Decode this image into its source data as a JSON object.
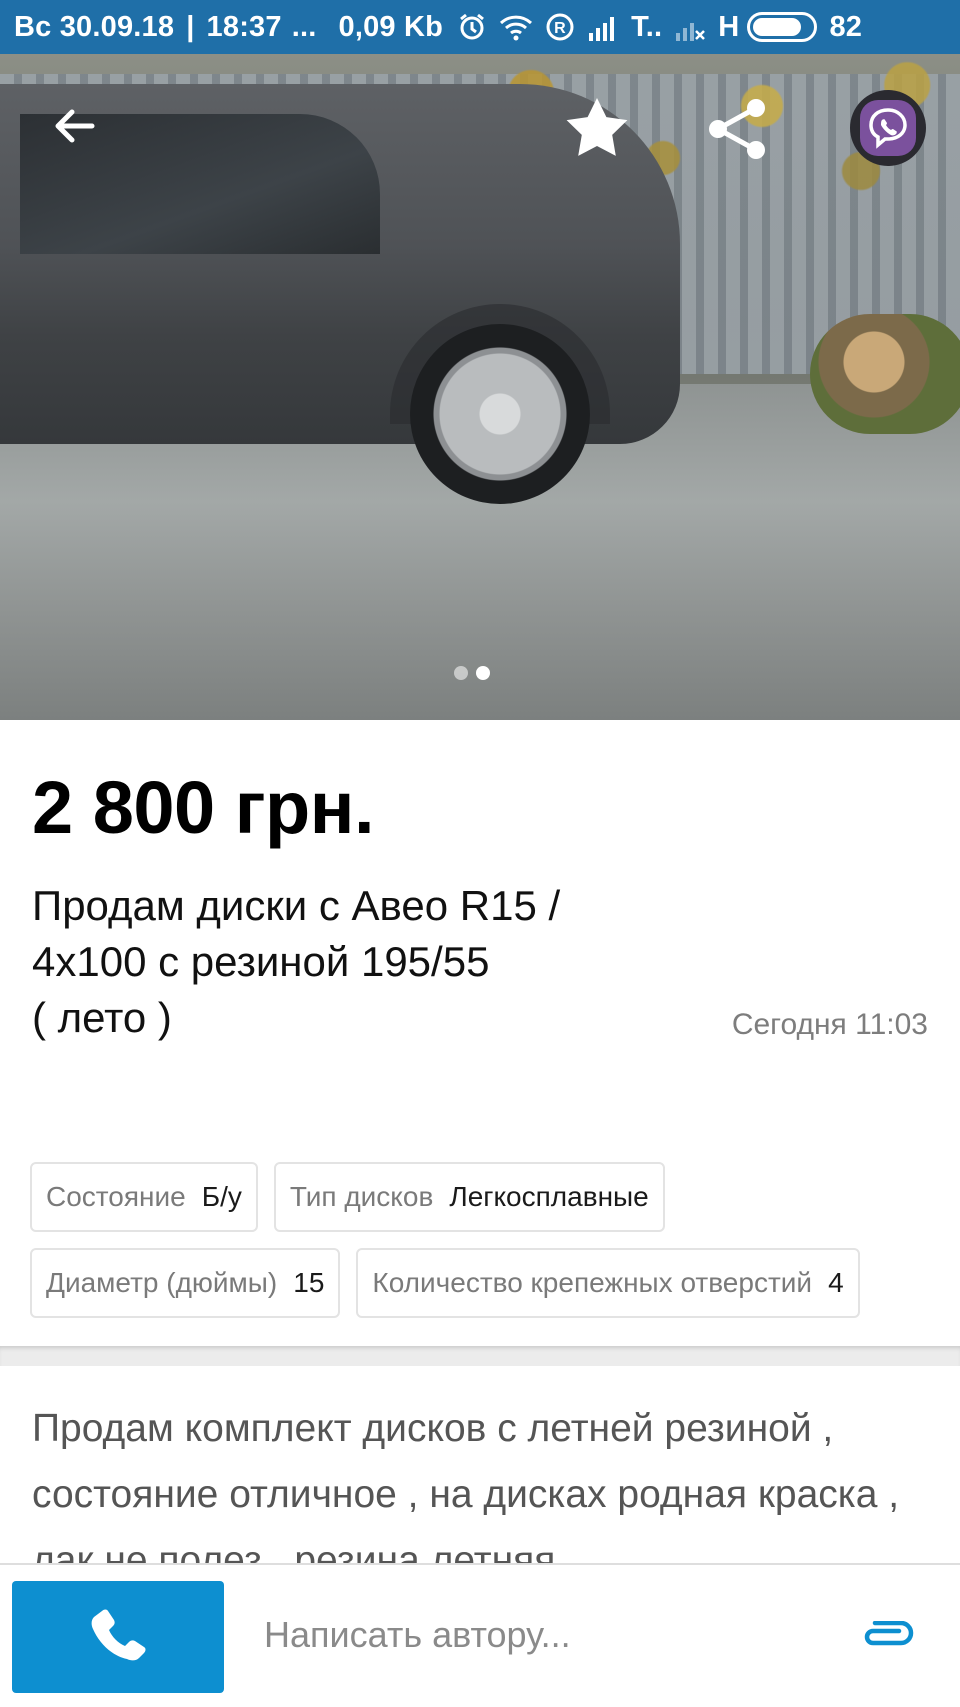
{
  "status_bar": {
    "day_date": "Вс 30.09.18",
    "separator": "|",
    "time": "18:37",
    "ellipsis": "...",
    "speed": "0,09 Kb",
    "carrier": "T..",
    "network": "H",
    "battery_percent": "82",
    "battery_level": 0.82,
    "icons": [
      "alarm-icon",
      "wifi-icon",
      "roaming-icon",
      "signal-icon",
      "signal-off-icon",
      "battery-icon"
    ]
  },
  "gallery": {
    "photo_count": 2,
    "active_index": 1,
    "buttons": [
      "back-arrow-icon",
      "star-icon",
      "share-icon",
      "viber-icon"
    ]
  },
  "listing": {
    "price": "2 800 грн.",
    "title": "Продам диски с Авео R15 /\n4х100 с резиной 195/55\n( лето )",
    "date": "Сегодня 11:03"
  },
  "params": [
    {
      "key": "Состояние",
      "value": "Б/у"
    },
    {
      "key": "Тип дисков",
      "value": "Легкосплавные"
    },
    {
      "key": "Диаметр (дюймы)",
      "value": "15"
    },
    {
      "key": "Количество крепежных отверстий",
      "value": "4"
    }
  ],
  "description": "Продам комплект дисков с летней резиной , состояние отличное , на дисках родная краска , лак не полез , резина летняя",
  "bottom_bar": {
    "message_placeholder": "Написать автору...",
    "accent_color": "#0d8fd0"
  },
  "colors": {
    "status_bar": "#1f6fa8",
    "price": "#000000",
    "date": "#7d7d7d",
    "chip_border": "#e3e3e3"
  }
}
